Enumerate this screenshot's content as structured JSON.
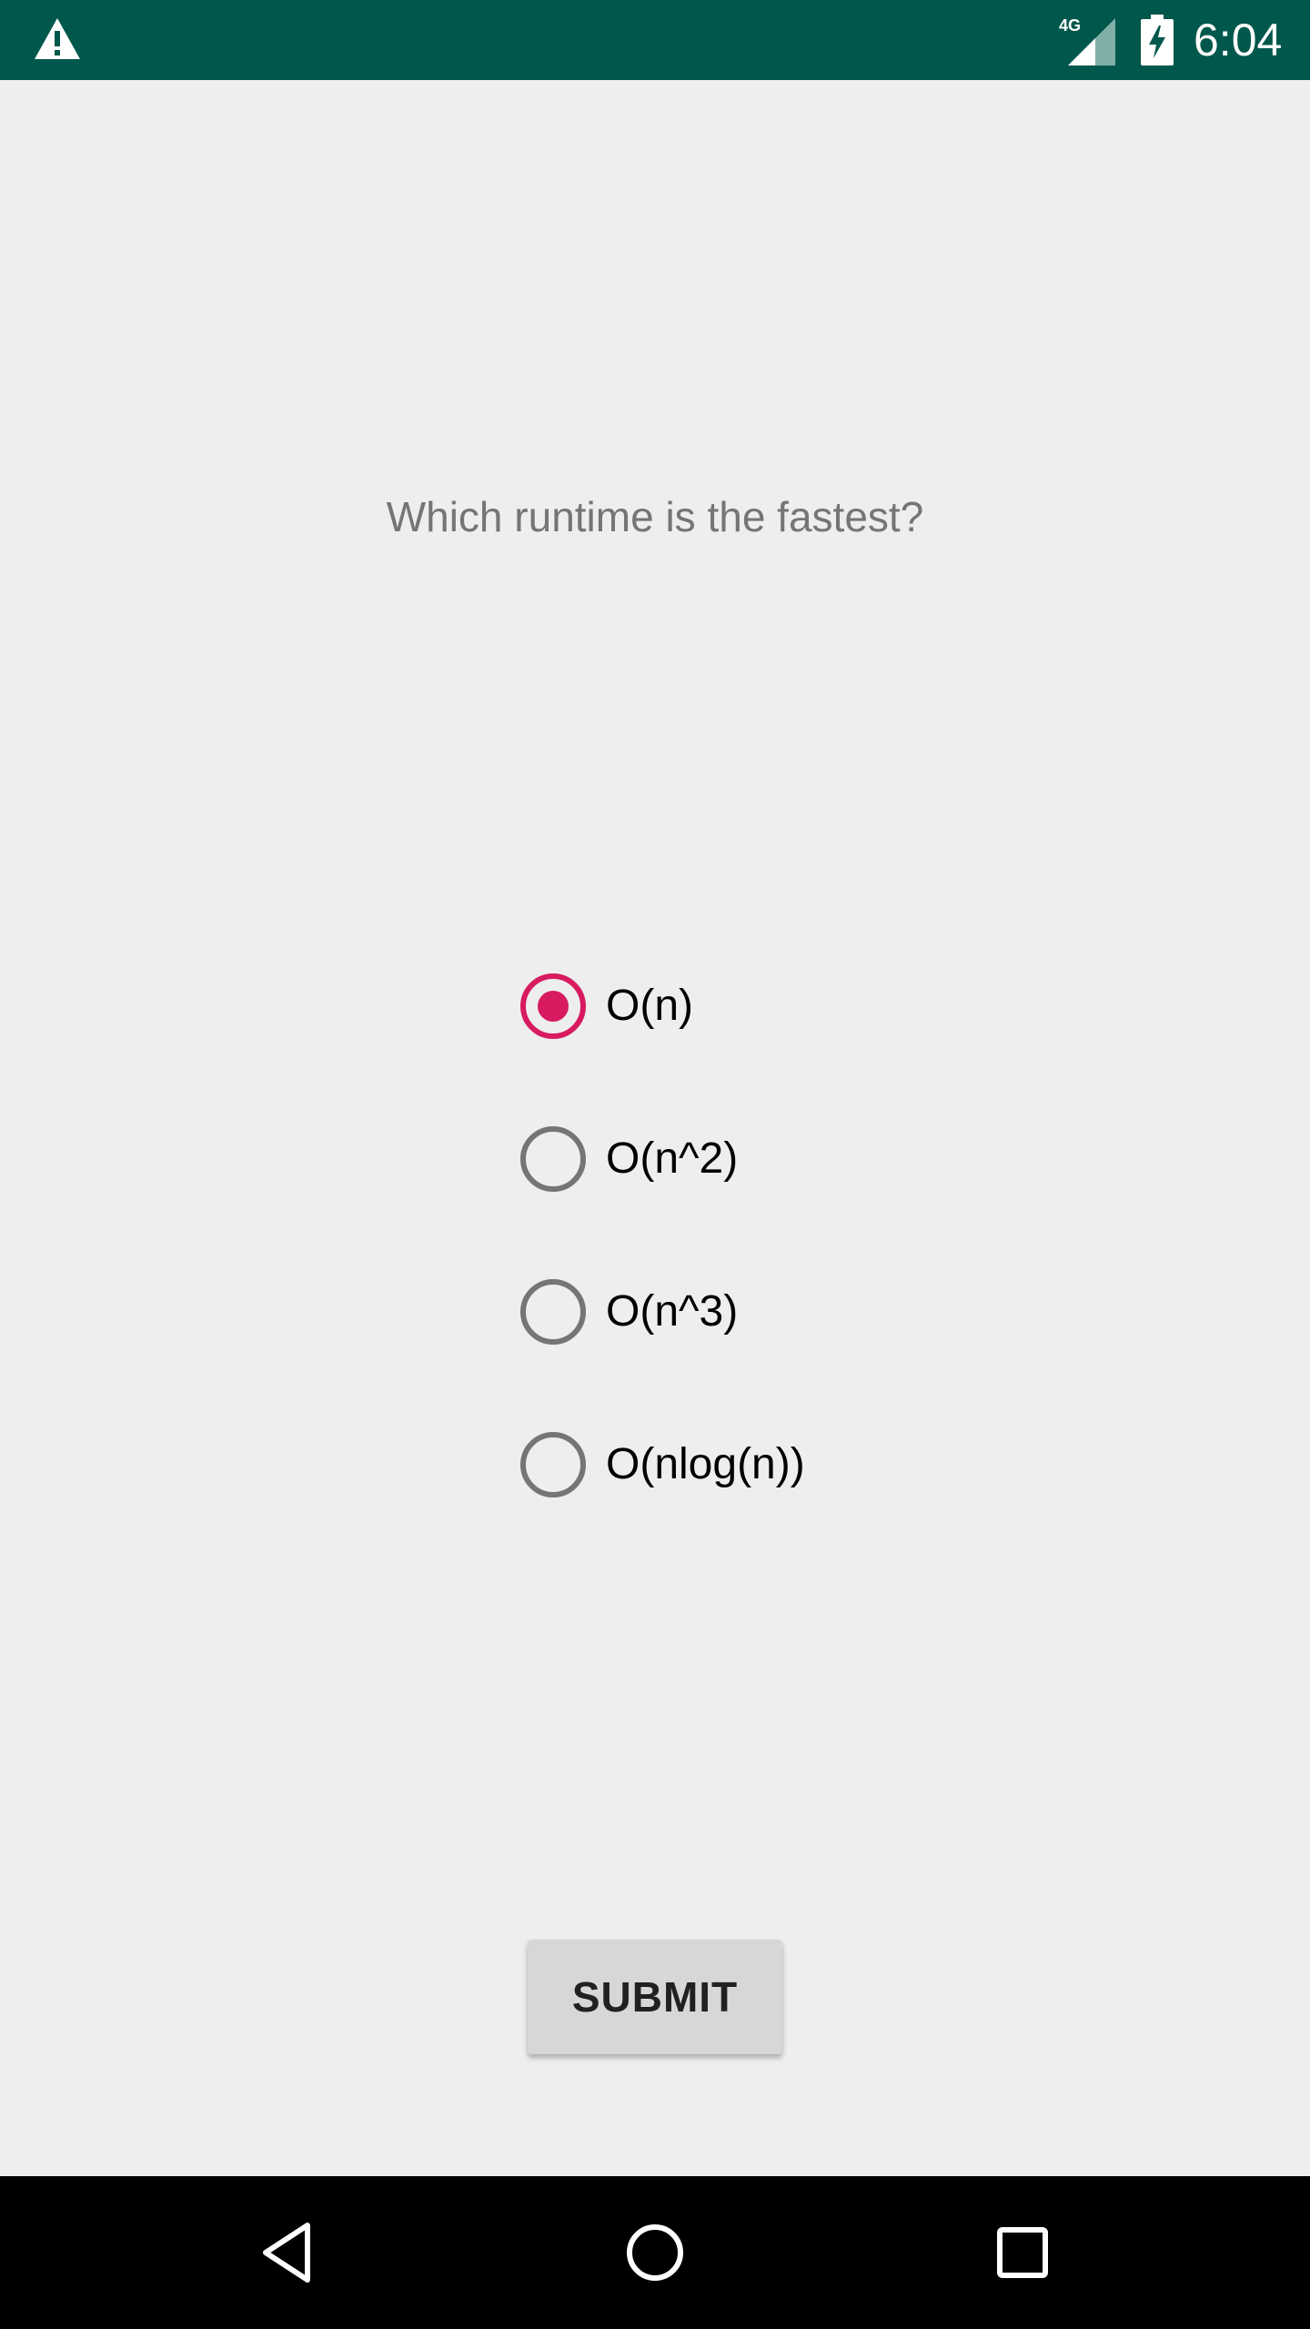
{
  "status_bar": {
    "network_label": "4G",
    "time": "6:04",
    "background": "#00574B",
    "icons": [
      "warning-icon",
      "signal-icon",
      "battery-charging-icon"
    ]
  },
  "quiz": {
    "question": "Which runtime is the fastest?",
    "options": [
      {
        "label": "O(n)",
        "checked": true
      },
      {
        "label": "O(n^2)",
        "checked": false
      },
      {
        "label": "O(n^3)",
        "checked": false
      },
      {
        "label": "O(nlog(n))",
        "checked": false
      }
    ],
    "submit_label": "SUBMIT",
    "accent_color": "#D81B60"
  },
  "nav_bar": {
    "icons": [
      "back-icon",
      "home-icon",
      "recents-icon"
    ]
  }
}
